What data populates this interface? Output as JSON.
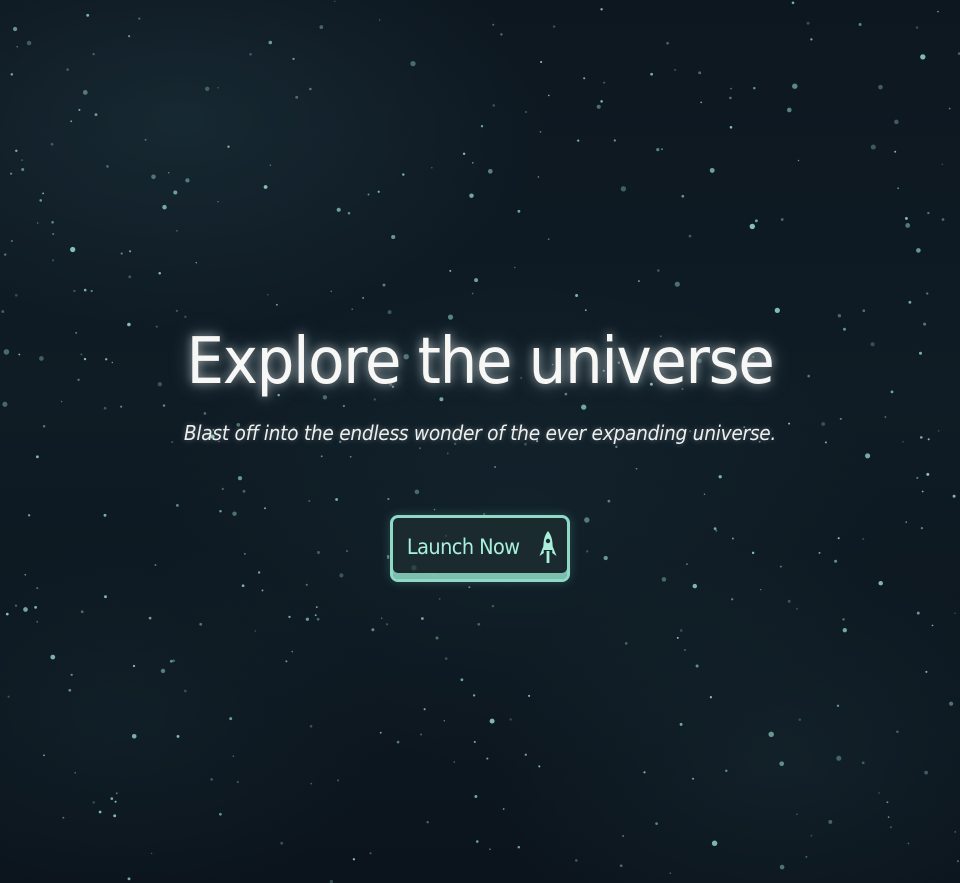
{
  "hero": {
    "title": "Explore the universe",
    "subtitle": "Blast off into the endless wonder of the ever expanding universe.",
    "cta_label": "Launch Now",
    "cta_icon": "rocket-icon"
  },
  "colors": {
    "background": "#0f1c25",
    "title": "#f7f7f5",
    "accent": "#8fd9c6",
    "button_text": "#a9f0dc",
    "star": "#9fe3d4"
  }
}
